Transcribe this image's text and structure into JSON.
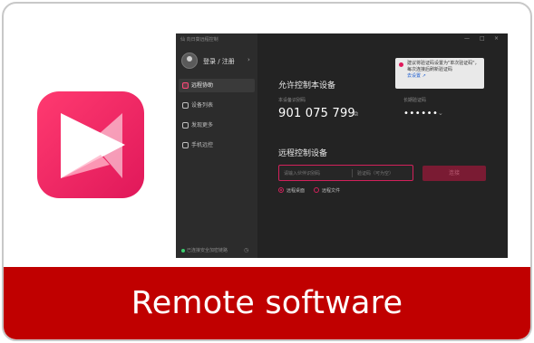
{
  "banner": {
    "title": "Remote software"
  },
  "app_window": {
    "title_text": "仙 向日葵远程控制",
    "window_controls": [
      "—",
      "□",
      "×"
    ],
    "login_label": "登录 / 注册",
    "nav": [
      {
        "label": "远程协助",
        "active": true
      },
      {
        "label": "设备列表",
        "active": false
      },
      {
        "label": "发现更多",
        "active": false
      },
      {
        "label": "手机远控",
        "active": false
      }
    ],
    "status_text": "已连接安全加密链路",
    "allow_control": {
      "heading": "允许控制本设备",
      "device_code_label": "本设备识别码",
      "device_code": "901 075 799",
      "password_label": "长期验证码",
      "password_mask": "••••••"
    },
    "tip": {
      "line1": "建议将验证码设置为\"单次验证码\"，",
      "line2": "每次连接后刷新验证码",
      "link": "去设置 ↗"
    },
    "remote_control": {
      "heading": "远程控制设备",
      "input_placeholder": "请输入伙伴识别码",
      "code_placeholder": "验证码（可为空）",
      "connect_label": "连接",
      "options": [
        {
          "label": "远程桌面",
          "selected": true
        },
        {
          "label": "远程文件",
          "selected": false
        }
      ]
    }
  },
  "colors": {
    "banner": "#c00000",
    "accent": "#e0185a",
    "window_bg": "#232323"
  },
  "icons": [
    "app-logo-icon",
    "avatar-icon",
    "copy-icon",
    "chevron-down-icon",
    "info-icon",
    "status-dot-icon"
  ]
}
